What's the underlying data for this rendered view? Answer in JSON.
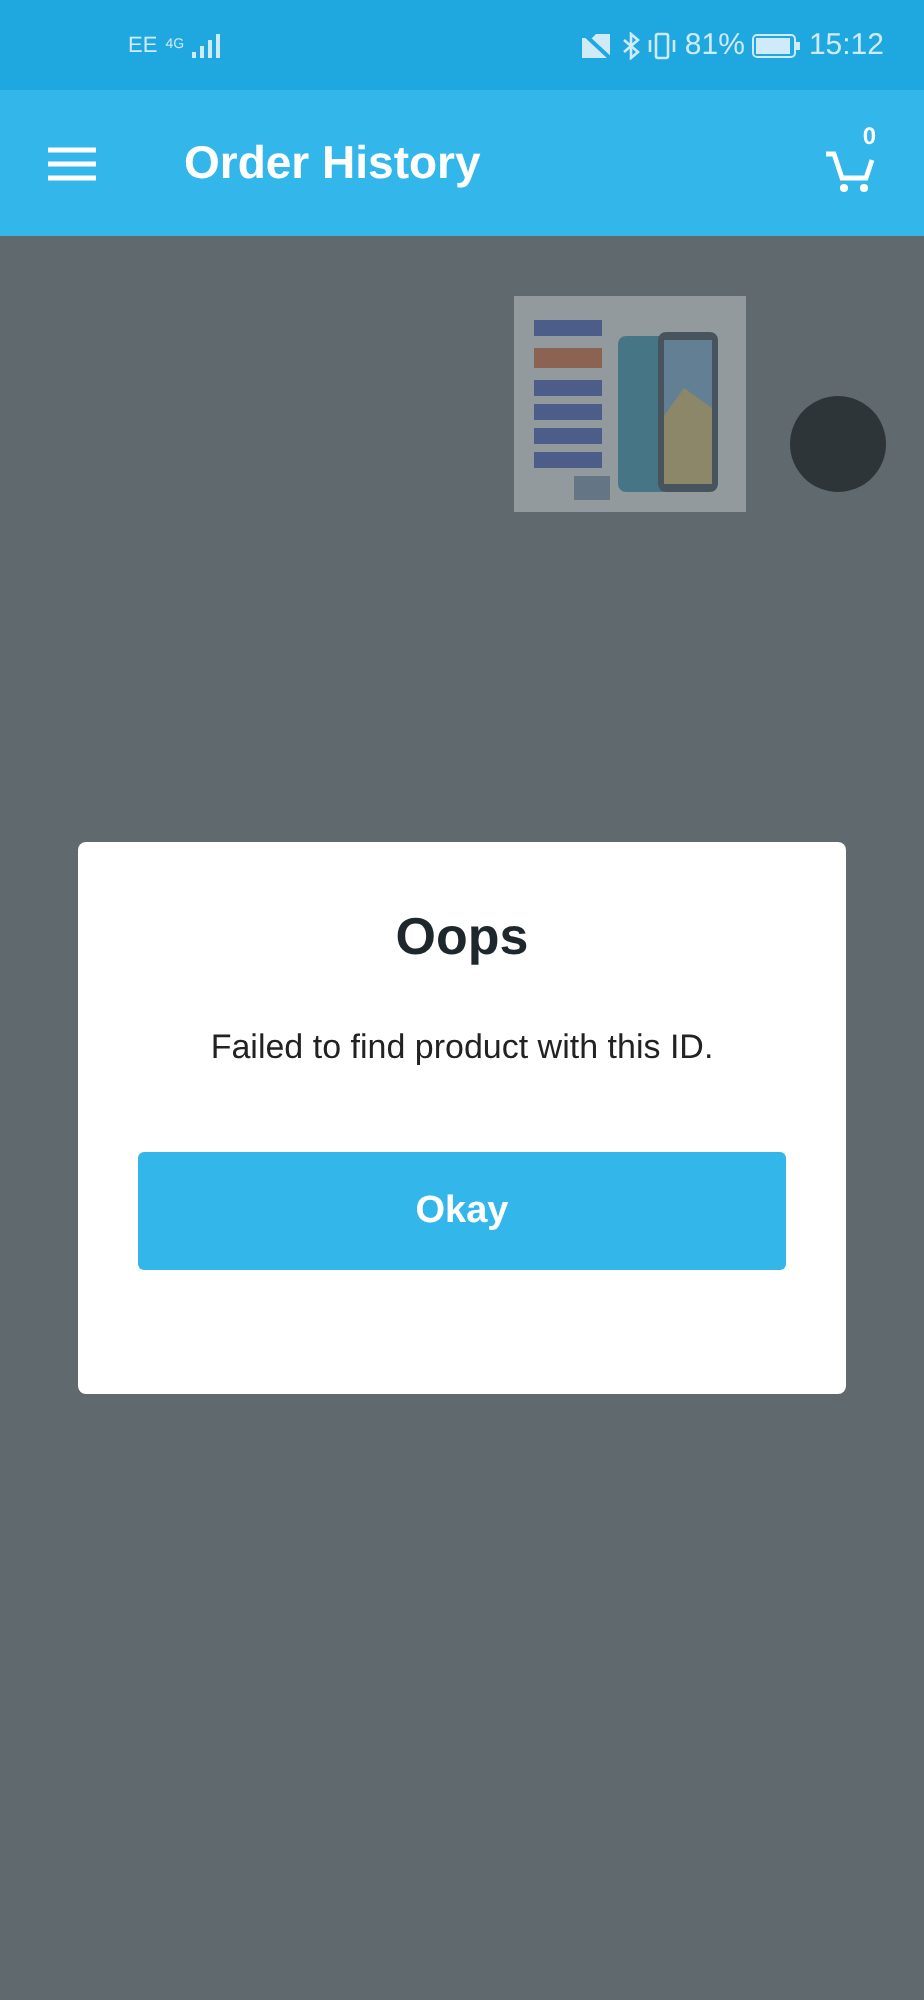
{
  "status_bar": {
    "carrier": "EE",
    "network": "4G",
    "battery": "81%",
    "time": "15:12"
  },
  "app_bar": {
    "title": "Order History",
    "cart_count": "0"
  },
  "dialog": {
    "title": "Oops",
    "message": "Failed to find product with this ID.",
    "button": "Okay"
  }
}
